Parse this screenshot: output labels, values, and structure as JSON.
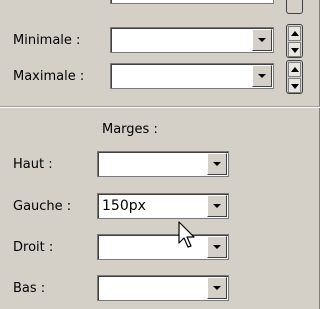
{
  "size_section": {
    "minimale": {
      "label": "Minimale :",
      "value": ""
    },
    "maximale": {
      "label": "Maximale :",
      "value": ""
    }
  },
  "margins_section": {
    "title": "Marges :",
    "fields": [
      {
        "label": "Haut :",
        "value": ""
      },
      {
        "label": "Gauche :",
        "value": "150px"
      },
      {
        "label": "Droit :",
        "value": ""
      },
      {
        "label": "Bas :",
        "value": ""
      }
    ]
  },
  "icons": {
    "dropdown": "chevron-down-icon",
    "spin_up": "arrow-up-icon",
    "spin_down": "arrow-down-icon",
    "cursor": "mouse-pointer-icon"
  }
}
